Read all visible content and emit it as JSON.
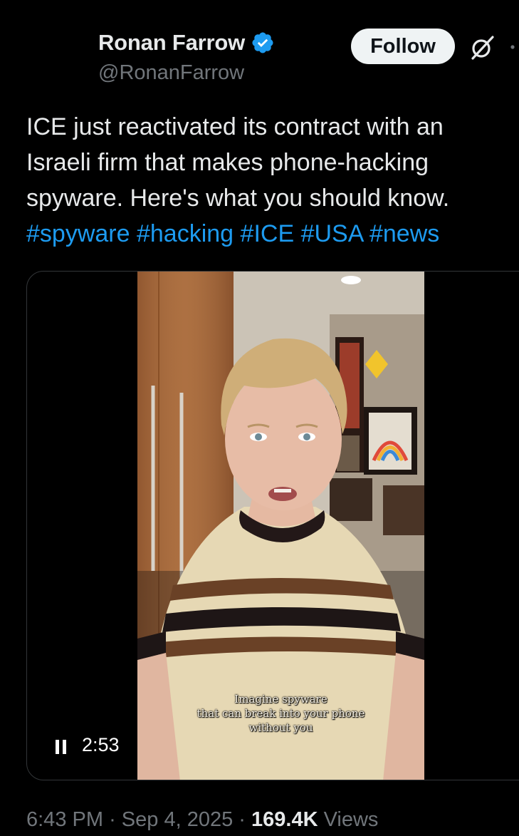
{
  "author": {
    "name": "Ronan Farrow",
    "handle": "@RonanFarrow",
    "verified": true
  },
  "actions": {
    "follow_label": "Follow",
    "grok_icon": "grok-slash-icon",
    "more_icon": "more-icon"
  },
  "tweet": {
    "text": "ICE just reactivated its contract with an Israeli firm that makes phone-hacking spyware. Here's what you should know.",
    "hashtags": [
      "#spyware",
      "#hacking",
      "#ICE",
      "#USA",
      "#news"
    ]
  },
  "video": {
    "caption_line1": "Imagine spyware",
    "caption_line2": "that can break into your phone",
    "caption_line3": "without you",
    "duration": "2:53",
    "playing": true
  },
  "footer": {
    "time": "6:43 PM",
    "separator": "·",
    "date": "Sep 4, 2025",
    "views_count": "169.4K",
    "views_label": "Views"
  },
  "colors": {
    "background": "#000000",
    "text_primary": "#e7e9ea",
    "text_secondary": "#71767b",
    "link": "#1d9bf0",
    "verified": "#1d9bf0",
    "border": "#333639"
  }
}
